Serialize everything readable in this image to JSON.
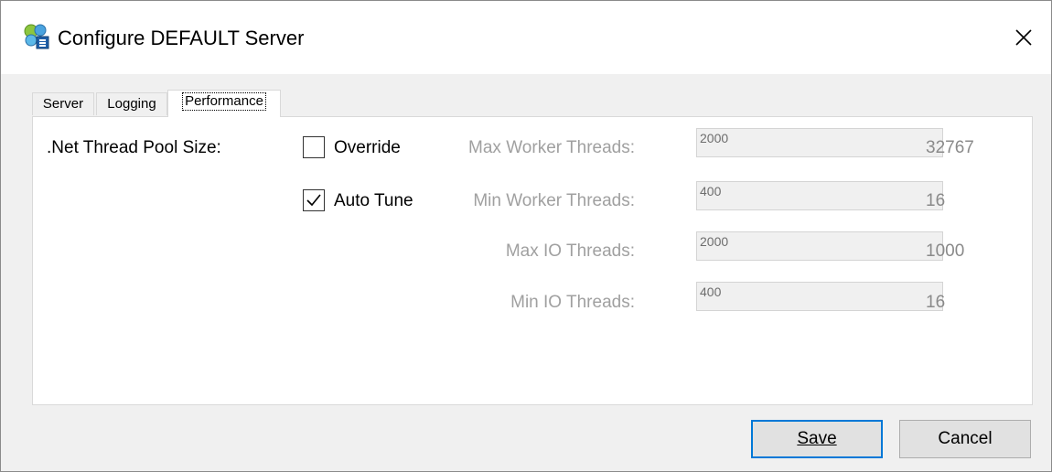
{
  "window": {
    "title": "Configure DEFAULT Server"
  },
  "tabs": [
    {
      "label": "Server"
    },
    {
      "label": "Logging"
    },
    {
      "label": "Performance"
    }
  ],
  "performance": {
    "pool_label": ".Net Thread Pool Size:",
    "override": {
      "label": "Override",
      "checked": false
    },
    "auto_tune": {
      "label": "Auto Tune",
      "checked": true
    },
    "fields": [
      {
        "label": "Max Worker Threads:",
        "value": "2000",
        "limit": "32767"
      },
      {
        "label": "Min Worker Threads:",
        "value": "400",
        "limit": "16"
      },
      {
        "label": "Max IO Threads:",
        "value": "2000",
        "limit": "1000"
      },
      {
        "label": "Min IO Threads:",
        "value": "400",
        "limit": "16"
      }
    ]
  },
  "buttons": {
    "save": "Save",
    "cancel": "Cancel"
  }
}
